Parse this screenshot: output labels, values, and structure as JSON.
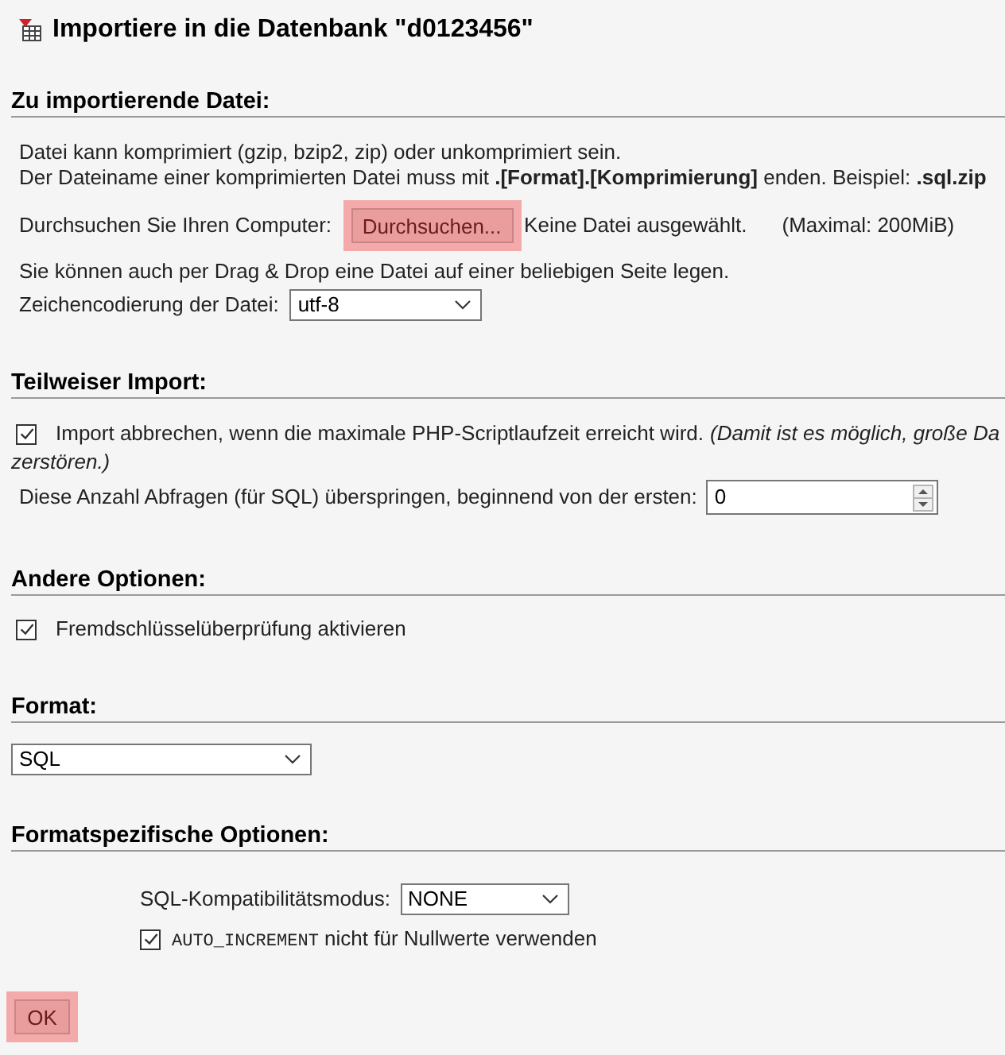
{
  "page_title": "Importiere in die Datenbank \"d0123456\"",
  "file_import": {
    "heading": "Zu importierende Datei:",
    "info_lines": [
      "Datei kann komprimiert (gzip, bzip2, zip) oder unkomprimiert sein.",
      "Der Dateiname einer komprimierten Datei muss mit **.[Format].[Komprimierung]** enden. Beispiel: **.sql.zip**"
    ],
    "browse_label": "Durchsuchen Sie Ihren Computer:",
    "browse_button": {
      "label": "Durchsuchen...",
      "highlighted": true
    },
    "file_status": "Keine Datei ausgewählt.",
    "max_size": "(Maximal: 200MiB)",
    "drag_hint": "Sie können auch per Drag & Drop eine Datei auf einer beliebigen Seite legen.",
    "charset": {
      "label": "Zeichencodierung der Datei:",
      "value": "utf-8"
    }
  },
  "partial_import": {
    "heading": "Teilweiser Import:",
    "interrupt": {
      "checked": true,
      "label": "Import abbrechen, wenn die maximale PHP-Scriptlaufzeit erreicht wird.",
      "note": "(Damit ist es möglich, große Da",
      "note_continued": "zerstören.)"
    },
    "skip": {
      "label": "Diese Anzahl Abfragen (für SQL) überspringen, beginnend von der ersten:",
      "value": "0"
    }
  },
  "other_options": {
    "heading": "Andere Optionen:",
    "foreign_key_checks": {
      "checked": true,
      "label": "Fremdschlüsselüberprüfung aktivieren"
    }
  },
  "format": {
    "heading": "Format:",
    "value": "SQL"
  },
  "format_options": {
    "heading": "Formatspezifische Optionen:",
    "compatibility": {
      "label": "SQL-Kompatibilitätsmodus:",
      "value": "NONE"
    },
    "no_auto_value": {
      "checked": true,
      "code": "AUTO_INCREMENT",
      "label": "nicht für Nullwerte verwenden"
    }
  },
  "submit_button": {
    "label": "OK",
    "highlighted": true
  }
}
